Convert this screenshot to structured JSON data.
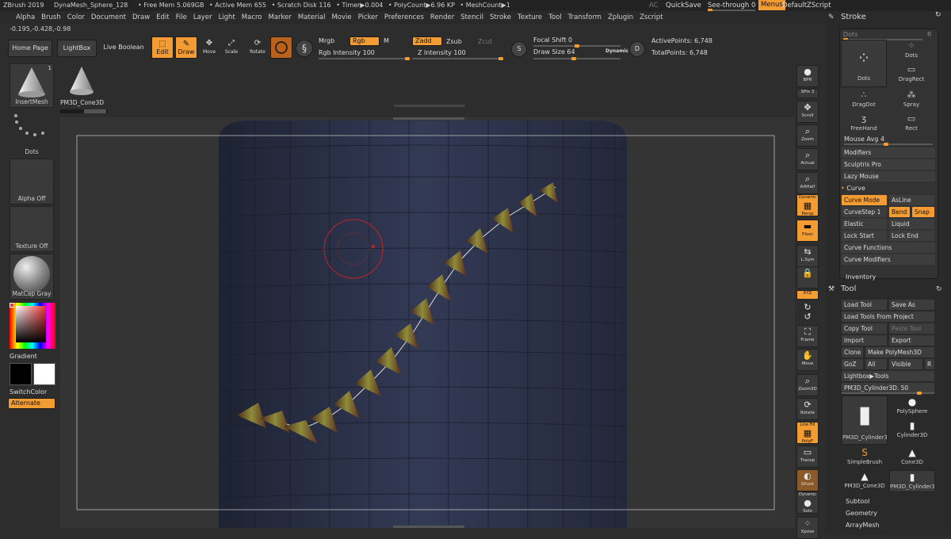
{
  "title": {
    "app": "ZBrush 2019",
    "doc": "DynaMesh_Sphere_128",
    "free_mem": "• Free Mem 5.069GB",
    "active_mem": "• Active Mem 655",
    "scratch": "• Scratch Disk 116",
    "timer": "• Timer▶0.004",
    "polycount": "• PolyCount▶6.96 KP",
    "meshcount": "• MeshCount▶1"
  },
  "top_right": {
    "ac": "AC",
    "quicksave": "QuickSave",
    "seethrough": "See-through  0",
    "menus": "Menus",
    "script": "DefaultZScript"
  },
  "menu": [
    "Alpha",
    "Brush",
    "Color",
    "Document",
    "Draw",
    "Edit",
    "File",
    "Layer",
    "Light",
    "Macro",
    "Marker",
    "Material",
    "Movie",
    "Picker",
    "Preferences",
    "Render",
    "Stencil",
    "Stroke",
    "Texture",
    "Tool",
    "Transform",
    "Zplugin",
    "Zscript"
  ],
  "coords": "-0.195,-0.428,-0.98",
  "shelf": {
    "home": "Home Page",
    "lightbox": "LightBox",
    "liveboolean": "Live Boolean",
    "edit": "Edit",
    "draw": "Draw",
    "move": "Move",
    "scale": "Scale",
    "rotate": "Rotate",
    "mrgb": "Mrgb",
    "rgb": "Rgb",
    "m": "M",
    "rgb_intensity": "Rgb Intensity 100",
    "zadd": "Zadd",
    "zsub": "Zsub",
    "zcut": "Zcut",
    "z_intensity": "Z Intensity 100",
    "focal_shift": "Focal Shift 0",
    "draw_size": "Draw Size 64",
    "dynamic": "Dynamic",
    "active_points": "ActivePoints: 6,748",
    "total_points": "TotalPoints: 6,748",
    "s_label": "S",
    "d_label": "D"
  },
  "left": {
    "insertmesh": "InsertMesh",
    "insertmesh_count": "1",
    "cone_name": "PM3D_Cone3D",
    "dots": "Dots",
    "alpha_off": "Alpha Off",
    "texture_off": "Texture Off",
    "matcap": "MatCap Gray",
    "gradient": "Gradient",
    "switchcolor": "SwitchColor",
    "alternate": "Alternate"
  },
  "rightbar": [
    {
      "name": "bpr",
      "label": "BPR",
      "icon": "●"
    },
    {
      "name": "spix",
      "label": "SPix 3",
      "icon": ""
    },
    {
      "name": "scroll",
      "label": "Scroll",
      "icon": "✥"
    },
    {
      "name": "zoom",
      "label": "Zoom",
      "icon": "⌕"
    },
    {
      "name": "actual",
      "label": "Actual",
      "icon": "⌕"
    },
    {
      "name": "aahalf",
      "label": "AAHalf",
      "icon": "⌕"
    },
    {
      "name": "persp",
      "label": "Persp",
      "icon": "▦",
      "top": "Dynamic"
    },
    {
      "name": "floor",
      "label": "Floor",
      "icon": "▬"
    },
    {
      "name": "lsym",
      "label": "L.Sym",
      "icon": "⇆"
    },
    {
      "name": "lock",
      "label": "",
      "icon": "🔒"
    },
    {
      "name": "xyz",
      "label": "XYZ",
      "icon": ""
    },
    {
      "name": "rot1",
      "label": "",
      "icon": "↻"
    },
    {
      "name": "rot2",
      "label": "",
      "icon": "↺"
    },
    {
      "name": "frame",
      "label": "Frame",
      "icon": "⛶"
    },
    {
      "name": "move",
      "label": "Move",
      "icon": "✋"
    },
    {
      "name": "zoom3d",
      "label": "Zoom3D",
      "icon": "⌕"
    },
    {
      "name": "rotate",
      "label": "Rotate",
      "icon": "⟳"
    },
    {
      "name": "polyf",
      "label": "PolyF",
      "icon": "▦",
      "top": "Line Fill"
    },
    {
      "name": "transp",
      "label": "Transp",
      "icon": "▭"
    },
    {
      "name": "ghost",
      "label": "Ghost",
      "icon": "◐"
    },
    {
      "name": "solo",
      "label": "Solo",
      "icon": "●",
      "top": "Dynamic"
    },
    {
      "name": "xpose",
      "label": "Xpose",
      "icon": "⁘"
    }
  ],
  "stroke": {
    "header": "Stroke",
    "dots_slider": "Dots",
    "r": "R",
    "items": [
      "Dots",
      "Dots",
      "DragRect",
      "DragDot",
      "Spray",
      "FreeHand",
      "Rect"
    ],
    "mouse_avg": "Mouse Avg 4",
    "modifiers": "Modifiers",
    "sculptris": "Sculptris Pro",
    "lazymouse": "Lazy Mouse",
    "curve": "Curve",
    "curve_mode": "Curve Mode",
    "asline": "AsLine",
    "curvestep": "CurveStep 1",
    "bend": "Bend",
    "snap": "Snap",
    "elastic": "Elastic",
    "liquid": "Liquid",
    "lockstart": "Lock Start",
    "lockend": "Lock End",
    "curve_functions": "Curve Functions",
    "curve_modifiers": "Curve Modifiers",
    "inventory": "Inventory"
  },
  "tool": {
    "header": "Tool",
    "load_tool": "Load Tool",
    "save_as": "Save As",
    "load_project": "Load Tools From Project",
    "copy_tool": "Copy Tool",
    "paste_tool": "Paste Tool",
    "import": "Import",
    "export": "Export",
    "clone": "Clone",
    "make_polymesh": "Make PolyMesh3D",
    "goz": "GoZ",
    "all": "All",
    "visible": "Visible",
    "r": "R",
    "lightbox_tools": "Lightbox▶Tools",
    "current": "PM3D_Cylinder3D. 50",
    "thumbs": [
      "PM3D_Cylinder3",
      "PolySphere",
      "Cylinder3D",
      "SimpleBrush",
      "Cone3D",
      "PM3D_Cone3D",
      "PM3D_Cylinder3"
    ],
    "subtool": "Subtool",
    "geometry": "Geometry",
    "arraymesh": "ArrayMesh"
  },
  "colors": {
    "accent": "#f39c33",
    "bg": "#2d2d2d",
    "mesh": "#2b3145"
  }
}
